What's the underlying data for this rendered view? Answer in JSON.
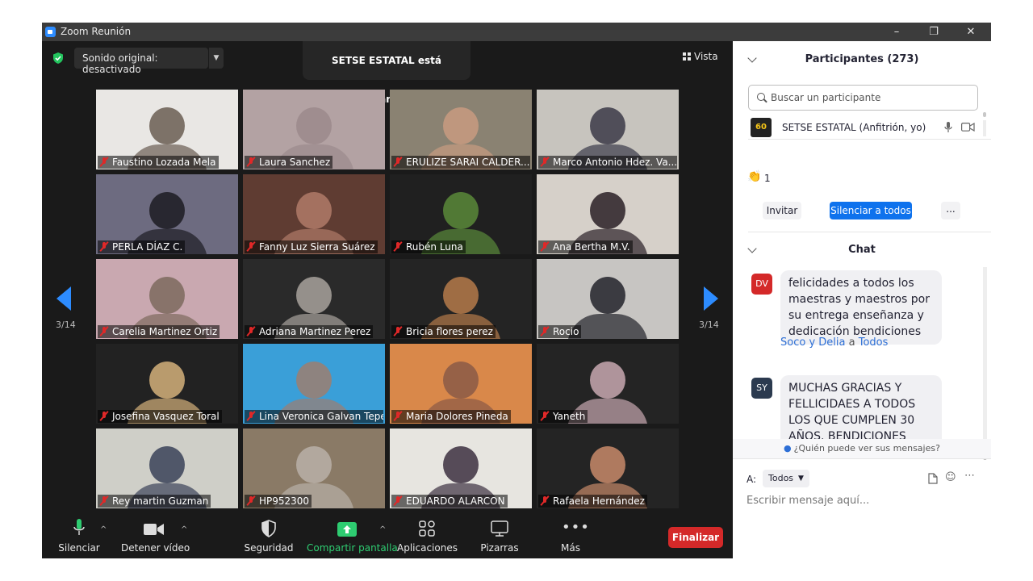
{
  "window": {
    "title": "Zoom Reunión",
    "controls": [
      "–",
      "❐",
      "✕"
    ]
  },
  "meeting": {
    "sound_original": "Sonido original: desactivado",
    "speaking_banner": "SETSE ESTATAL está hablando...",
    "view_label": "Vista",
    "page_left": "3/14",
    "page_right": "3/14"
  },
  "participants_grid": [
    {
      "name": "Faustino Lozada Mela",
      "bg": "#e9e7e4",
      "fg": "#6a5d52"
    },
    {
      "name": "Laura Sanchez",
      "bg": "#b3a2a3",
      "fg": "#9b8a8c"
    },
    {
      "name": "ERULIZE SARAI CALDER...",
      "bg": "#8a8272",
      "fg": "#c89b80"
    },
    {
      "name": "Marco Antonio Hdez. Va...",
      "bg": "#c7c4be",
      "fg": "#3b3a48"
    },
    {
      "name": "PERLA DÍAZ C.",
      "bg": "#6d6b80",
      "fg": "#1c1b22"
    },
    {
      "name": "Fanny Luz Sierra Suárez",
      "bg": "#5f3c32",
      "fg": "#b07a68"
    },
    {
      "name": "Rubén Luna",
      "bg": "#202020",
      "fg": "#5a8a3a"
    },
    {
      "name": "Ana Bertha M.V.",
      "bg": "#d6d0c9",
      "fg": "#2a2026"
    },
    {
      "name": "Carelia Martinez Ortiz",
      "bg": "#c9a8b0",
      "fg": "#7d6a5e"
    },
    {
      "name": "Adriana Martinez Perez",
      "bg": "#2a2a2a",
      "fg": "#a8a29c"
    },
    {
      "name": "Bricia flores perez",
      "bg": "#242424",
      "fg": "#b57a4a"
    },
    {
      "name": "Rocio",
      "bg": "#c7c5c2",
      "fg": "#22222a"
    },
    {
      "name": "Josefina Vasquez Toral",
      "bg": "#222222",
      "fg": "#d4b07a"
    },
    {
      "name": "Lina Veronica Galvan Tepetla",
      "bg": "#3a9fd8",
      "fg": "#9e7e70"
    },
    {
      "name": "Maria Dolores Pineda",
      "bg": "#d9884a",
      "fg": "#8a5a46"
    },
    {
      "name": "Yaneth",
      "bg": "#242424",
      "fg": "#c8a8b0"
    },
    {
      "name": "Rey martin Guzman",
      "bg": "#cfcfc8",
      "fg": "#3a4258"
    },
    {
      "name": "HP952300",
      "bg": "#8a7a66",
      "fg": "#b8b0a8"
    },
    {
      "name": "EDUARDO ALARCON",
      "bg": "#e7e5e0",
      "fg": "#3c3040"
    },
    {
      "name": "Rafaela Hernández",
      "bg": "#242424",
      "fg": "#c88a6a"
    }
  ],
  "toolbar": {
    "mute": "Silenciar",
    "stop_video": "Detener vídeo",
    "security": "Seguridad",
    "share": "Compartir pantalla",
    "apps": "Aplicaciones",
    "whiteboards": "Pizarras",
    "more": "Más",
    "end": "Finalizar"
  },
  "participants_panel": {
    "title": "Participantes (273)",
    "search_placeholder": "Buscar un participante",
    "host_name": "SETSE ESTATAL (Anfitrión, yo)",
    "host_avatar": "60",
    "reaction_count": "1",
    "invite": "Invitar",
    "mute_all": "Silenciar a todos",
    "more": "..."
  },
  "chat": {
    "title": "Chat",
    "messages": [
      {
        "avatar": "DV",
        "color": "#d42929",
        "text": "felicidades a todos los maestras y maestros por su entrega enseñanza y dedicación bendiciones"
      },
      {
        "avatar": "SY",
        "color": "#2b3a4f",
        "sender": "Soco y Delia",
        "to_word": "a",
        "recipient": "Todos",
        "text": "MUCHAS GRACIAS Y FELLICIDAES A TODOS LOS QUE CUMPLEN 30 AÑOS. BENDICIONES"
      }
    ],
    "who_can_see": "¿Quién puede ver sus mensajes?",
    "to_label": "A:",
    "to_value": "Todos",
    "compose_placeholder": "Escribir mensaje aquí..."
  }
}
